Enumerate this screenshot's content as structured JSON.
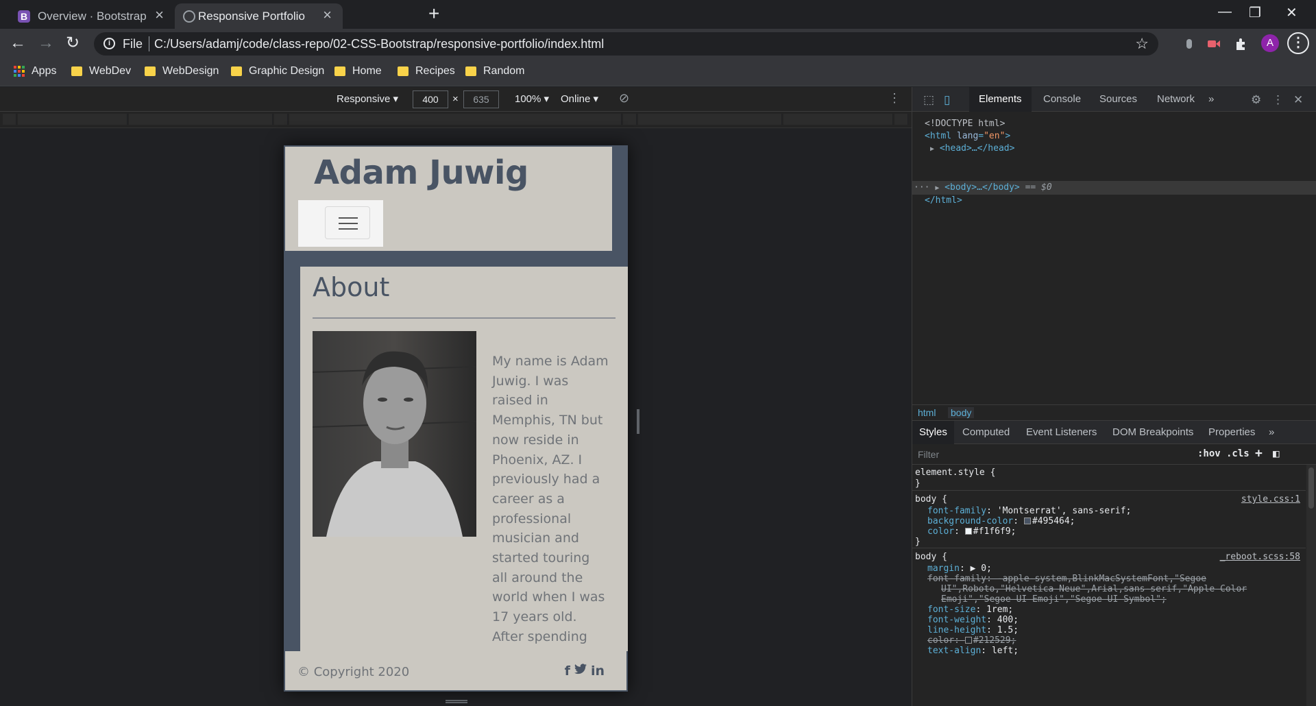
{
  "browser": {
    "tabs": [
      {
        "title": "Overview · Bootstrap",
        "icon": "bootstrap-icon",
        "favicon_letter": "B"
      },
      {
        "title": "Responsive Portfolio",
        "icon": "globe-icon"
      }
    ],
    "address": {
      "scheme_label": "File",
      "url": "C:/Users/adamj/code/class-repo/02-CSS-Bootstrap/responsive-portfolio/index.html"
    },
    "profile_initial": "A",
    "bookmarks": [
      "Apps",
      "WebDev",
      "WebDesign",
      "Graphic Design",
      "Home",
      "Recipes",
      "Random"
    ]
  },
  "device_toolbar": {
    "mode": "Responsive ▾",
    "width": "400",
    "times": "×",
    "height": "635",
    "zoom": "100% ▾",
    "network": "Online ▾"
  },
  "page": {
    "brand": "Adam Juwig",
    "about_title": "About",
    "about_text": "My name is Adam Juwig. I was raised in Memphis, TN but now reside in Phoenix, AZ. I previously had a career as a professional musician and started touring all around the world when I was 17 years old. After spending",
    "copyright": "© Copyright 2020",
    "social_icons": [
      "facebook-icon",
      "twitter-icon",
      "linkedin-icon"
    ],
    "social_glyphs": {
      "facebook": "f",
      "twitter": "🐦",
      "linkedin": "in"
    },
    "colors": {
      "body_bg": "#495464",
      "card_bg": "#cbc8c1",
      "text": "#6f7378"
    }
  },
  "devtools": {
    "tabs": [
      "Elements",
      "Console",
      "Sources",
      "Network",
      "»"
    ],
    "dom": {
      "doctype": "<!DOCTYPE html>",
      "html_open_tag": "html",
      "html_attr": "lang",
      "html_attr_val": "\"en\"",
      "head": "<head>…</head>",
      "body": "<body>…</body>",
      "body_eq": "== $0",
      "html_close": "</html>"
    },
    "breadcrumbs": [
      "html",
      "body"
    ],
    "styles_tabs": [
      "Styles",
      "Computed",
      "Event Listeners",
      "DOM Breakpoints",
      "Properties",
      "»"
    ],
    "filter_placeholder": "Filter",
    "filter_hov": ":hov",
    "filter_cls": ".cls",
    "rules": {
      "element_style": {
        "selector": "element.style {",
        "close": "}"
      },
      "body1": {
        "selector": "body {",
        "source": "style.css:1",
        "props": [
          {
            "name": "font-family",
            "value": "'Montserrat', sans-serif;"
          },
          {
            "name": "background-color",
            "value": "#495464;",
            "swatch": "#495464"
          },
          {
            "name": "color",
            "value": "#f1f6f9;",
            "swatch": "#f1f6f9"
          }
        ],
        "close": "}"
      },
      "body2": {
        "selector": "body {",
        "source": "_reboot.scss:58",
        "margin": {
          "name": "margin",
          "value": "▶ 0;"
        },
        "font_family_strike": [
          "font-family: -apple-system,BlinkMacSystemFont,\"Segoe",
          "UI\",Roboto,\"Helvetica Neue\",Arial,sans-serif,\"Apple Color",
          "Emoji\",\"Segoe UI Emoji\",\"Segoe UI Symbol\";"
        ],
        "props": [
          {
            "name": "font-size",
            "value": "1rem;"
          },
          {
            "name": "font-weight",
            "value": "400;"
          },
          {
            "name": "line-height",
            "value": "1.5;"
          }
        ],
        "color_strike": {
          "name": "color",
          "value": "#212529;",
          "swatch": "#212529"
        },
        "text_align": {
          "name": "text-align",
          "value": "left;"
        }
      }
    }
  }
}
